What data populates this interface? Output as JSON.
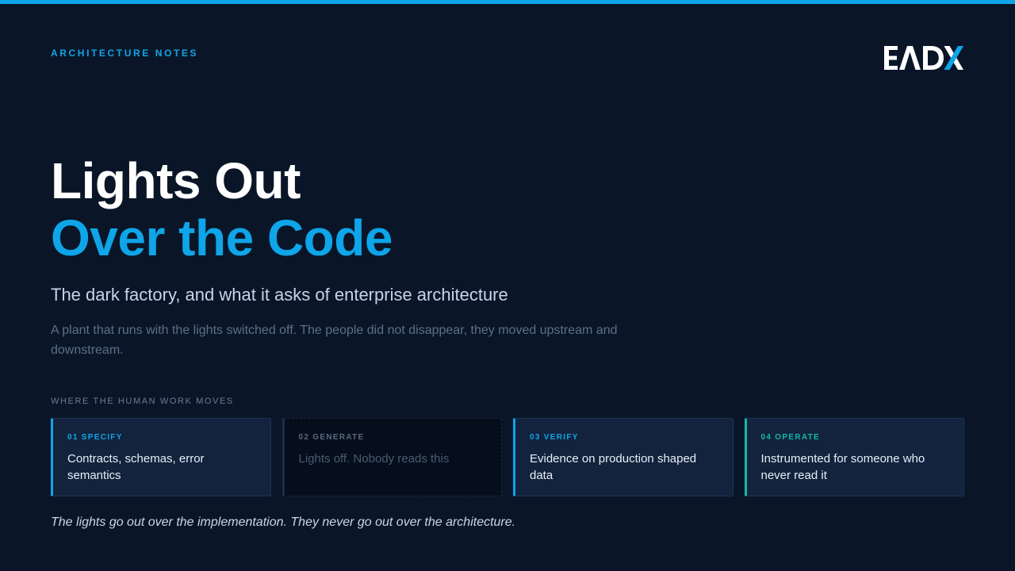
{
  "colors": {
    "background": "#0a1628",
    "accent": "#0ea5e9",
    "teal": "#14b8a6",
    "card": "#13233d"
  },
  "header": {
    "eyebrow": "ARCHITECTURE NOTES",
    "logo_text": "EADX"
  },
  "hero": {
    "title_line1": "Lights Out",
    "title_line2": "Over the Code",
    "subtitle": "The dark factory, and what it asks of enterprise architecture",
    "description": "A plant that runs with the lights switched off. The people did not disappear, they moved upstream and downstream."
  },
  "stages": {
    "label": "WHERE THE HUMAN WORK MOVES",
    "items": [
      {
        "number": "01 SPECIFY",
        "text": "Contracts, schemas, error semantics"
      },
      {
        "number": "02 GENERATE",
        "text": "Lights off. Nobody reads this"
      },
      {
        "number": "03 VERIFY",
        "text": "Evidence on production shaped data"
      },
      {
        "number": "04 OPERATE",
        "text": "Instrumented for someone who never read it"
      }
    ]
  },
  "footer": {
    "quote": "The lights go out over the implementation. They never go out over the architecture."
  }
}
